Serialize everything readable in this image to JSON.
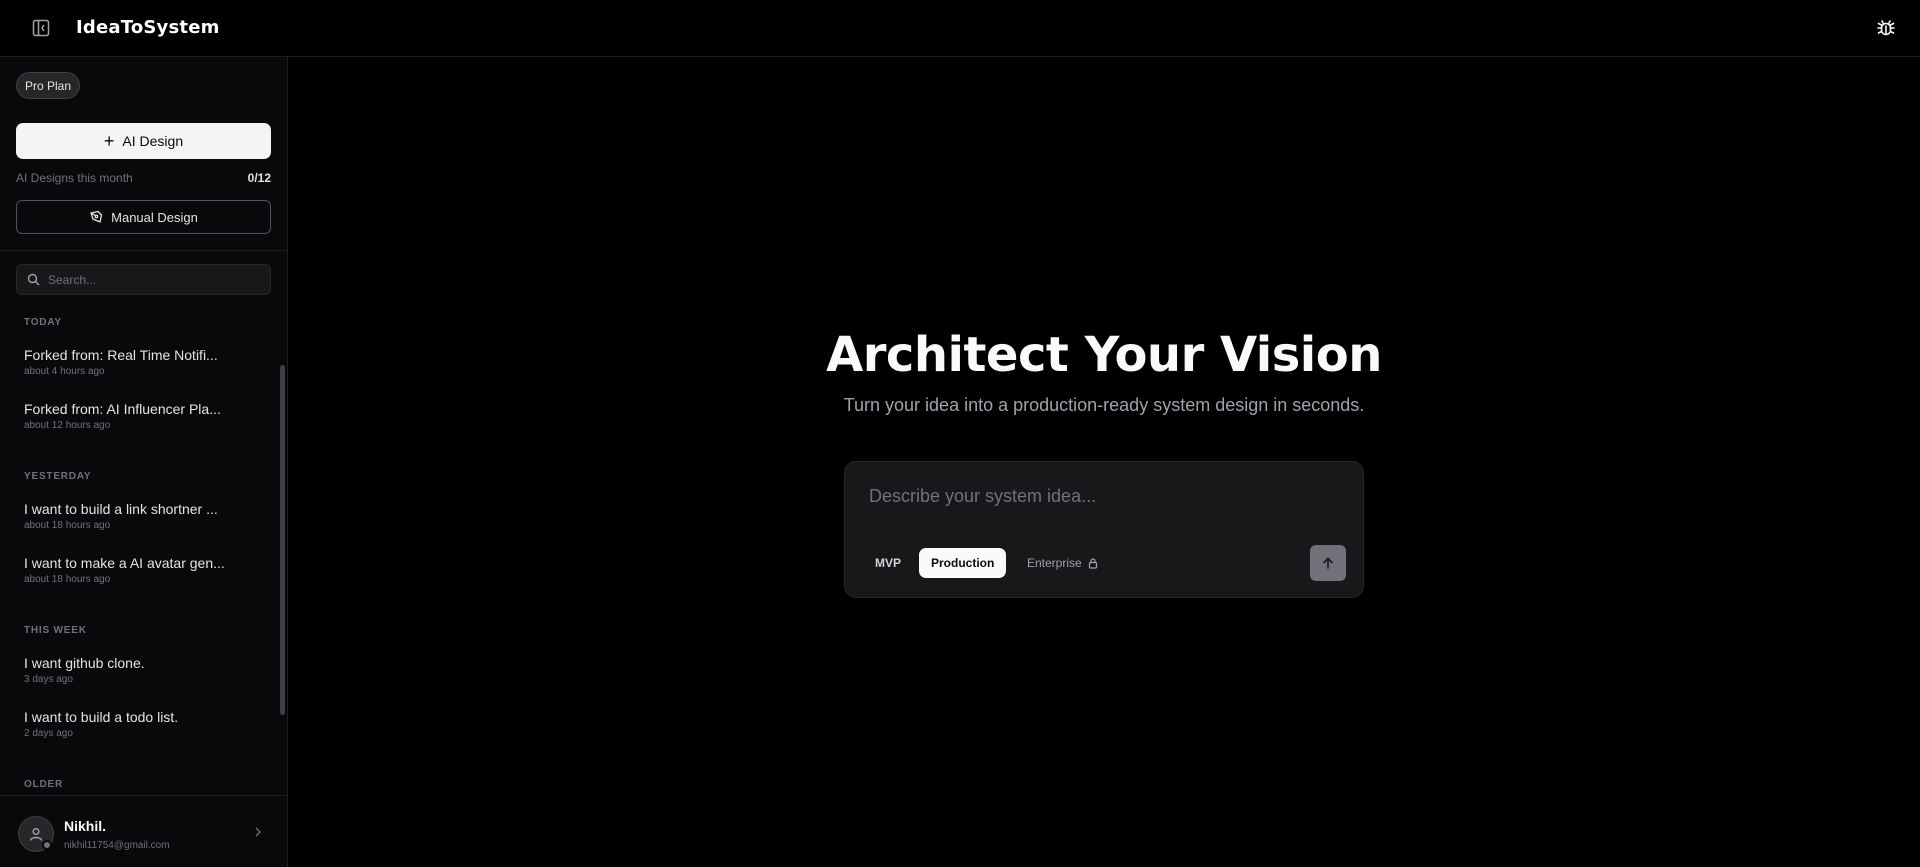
{
  "header": {
    "brand": "IdeaToSystem",
    "toggle_icon": "sidebar-toggle-icon",
    "bug_icon": "bug-icon"
  },
  "sidebar": {
    "plan_badge": "Pro Plan",
    "ai_design_label": "AI Design",
    "quota_label": "AI Designs this month",
    "quota_value": "0/12",
    "manual_design_label": "Manual Design",
    "search_placeholder": "Search...",
    "groups": [
      {
        "title": "TODAY",
        "items": [
          {
            "title": "Forked from: Real Time Notifi...",
            "time": "about 4 hours ago"
          },
          {
            "title": "Forked from: AI Influencer Pla...",
            "time": "about 12 hours ago"
          }
        ]
      },
      {
        "title": "YESTERDAY",
        "items": [
          {
            "title": "I want to build a link shortner ...",
            "time": "about 18 hours ago"
          },
          {
            "title": "I want to make a AI avatar gen...",
            "time": "about 18 hours ago"
          }
        ]
      },
      {
        "title": "THIS WEEK",
        "items": [
          {
            "title": "I want github clone.",
            "time": "3 days ago"
          },
          {
            "title": "I want to build a todo list.",
            "time": "2 days ago"
          }
        ]
      },
      {
        "title": "OLDER",
        "items": []
      }
    ],
    "user": {
      "name": "Nikhil.",
      "email": "nikhil11754@gmail.com"
    }
  },
  "main": {
    "title": "Architect Your Vision",
    "subtitle": "Turn your idea into a production-ready system design in seconds.",
    "prompt_placeholder": "Describe your system idea...",
    "tiers": {
      "mvp": "MVP",
      "production": "Production",
      "enterprise": "Enterprise"
    },
    "selected_tier": "Production"
  },
  "colors": {
    "background": "#000000",
    "sidebar": "#09090b",
    "card": "#18181b",
    "accent_light": "#f4f4f5",
    "muted": "#71717a"
  }
}
